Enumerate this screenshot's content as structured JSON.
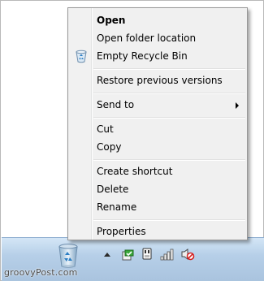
{
  "menu": {
    "items": {
      "open": "Open",
      "open_folder": "Open folder location",
      "empty_recycle_bin": "Empty Recycle Bin",
      "restore_versions": "Restore previous versions",
      "send_to": "Send to",
      "cut": "Cut",
      "copy": "Copy",
      "create_shortcut": "Create shortcut",
      "delete": "Delete",
      "rename": "Rename",
      "properties": "Properties"
    }
  },
  "desktop": {
    "recycle_bin_icon": "recycle-bin-icon"
  },
  "taskbar": {
    "tray_icons": [
      "show-hidden-icons-chevron",
      "green-flag-check-icon",
      "power-plug-icon",
      "network-signal-icon",
      "speaker-muted-icon"
    ]
  },
  "watermark": "groovyPost.com"
}
